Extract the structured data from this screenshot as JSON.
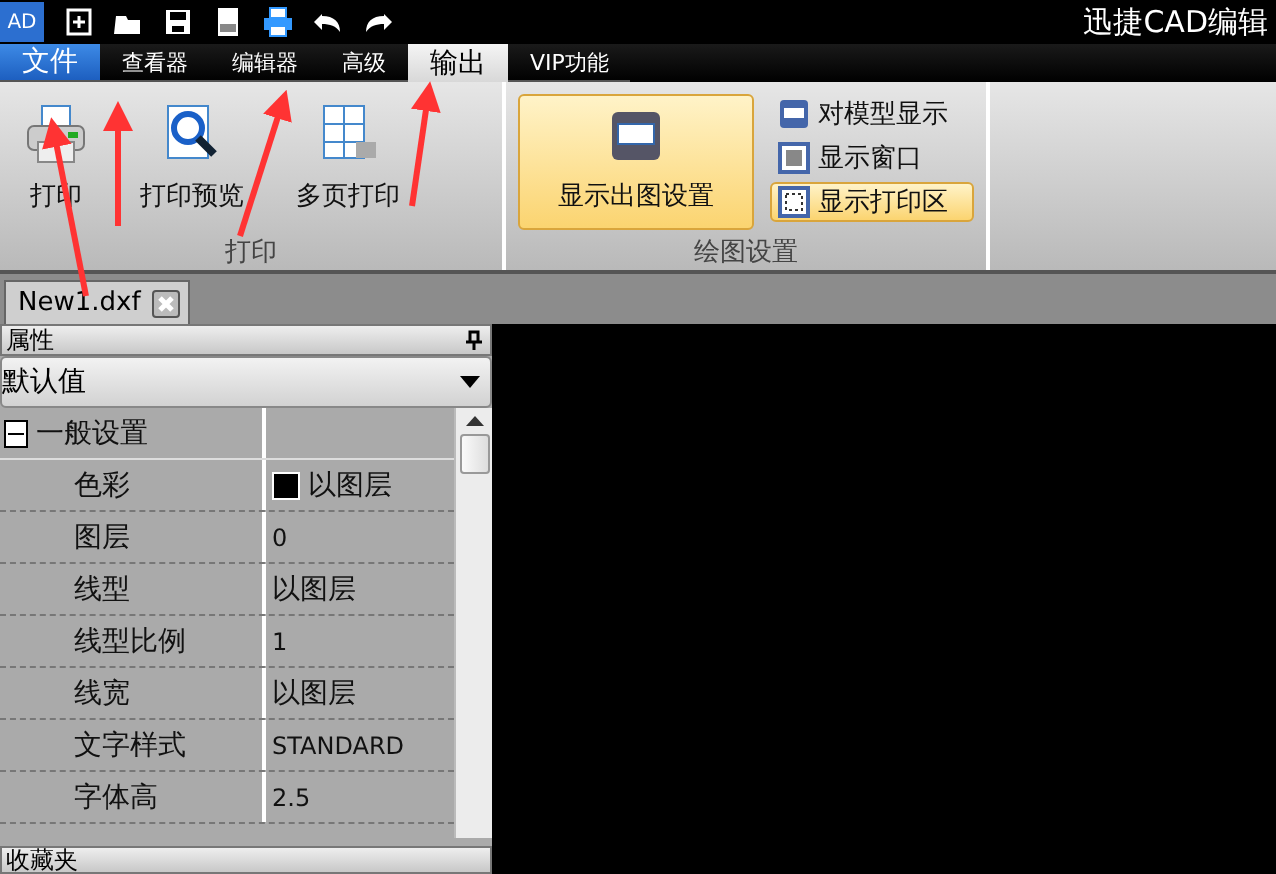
{
  "app": {
    "logo": "AD",
    "title": "迅捷CAD编辑"
  },
  "menu_tabs": [
    {
      "label": "文件",
      "kind": "file",
      "selected": false
    },
    {
      "label": "查看器",
      "kind": "tab",
      "selected": false
    },
    {
      "label": "编辑器",
      "kind": "tab",
      "selected": false
    },
    {
      "label": "高级",
      "kind": "tab",
      "selected": false
    },
    {
      "label": "输出",
      "kind": "tab",
      "selected": true
    },
    {
      "label": "VIP功能",
      "kind": "tab",
      "selected": false
    }
  ],
  "ribbon": {
    "print_group": {
      "label": "打印",
      "buttons": [
        {
          "label": "打印",
          "kind": "printer"
        },
        {
          "label": "打印预览",
          "kind": "preview"
        },
        {
          "label": "多页打印",
          "kind": "multipage"
        }
      ]
    },
    "plot_group": {
      "label": "绘图设置",
      "big_button": {
        "label": "显示出图设置",
        "selected": true
      },
      "options": [
        {
          "label": "对模型显示",
          "kind": "model",
          "selected": false
        },
        {
          "label": "显示窗口",
          "kind": "window",
          "selected": false
        },
        {
          "label": "显示打印区",
          "kind": "area",
          "selected": true
        }
      ]
    }
  },
  "doc_tabs": [
    {
      "label": "New1.dxf",
      "selected": true
    }
  ],
  "properties": {
    "title": "属性",
    "preset": "默认值",
    "category": {
      "label": "一般设置",
      "expanded": true
    },
    "rows": [
      {
        "name": "色彩",
        "value": "以图层",
        "kind": "color"
      },
      {
        "name": "图层",
        "value": "0",
        "kind": "text"
      },
      {
        "name": "线型",
        "value": "以图层",
        "kind": "text"
      },
      {
        "name": "线型比例",
        "value": "1",
        "kind": "text"
      },
      {
        "name": "线宽",
        "value": "以图层",
        "kind": "text"
      },
      {
        "name": "文字样式",
        "value": "STANDARD",
        "kind": "text"
      },
      {
        "name": "字体高",
        "value": "2.5",
        "kind": "text"
      }
    ]
  },
  "favorites": {
    "title": "收藏夹"
  }
}
